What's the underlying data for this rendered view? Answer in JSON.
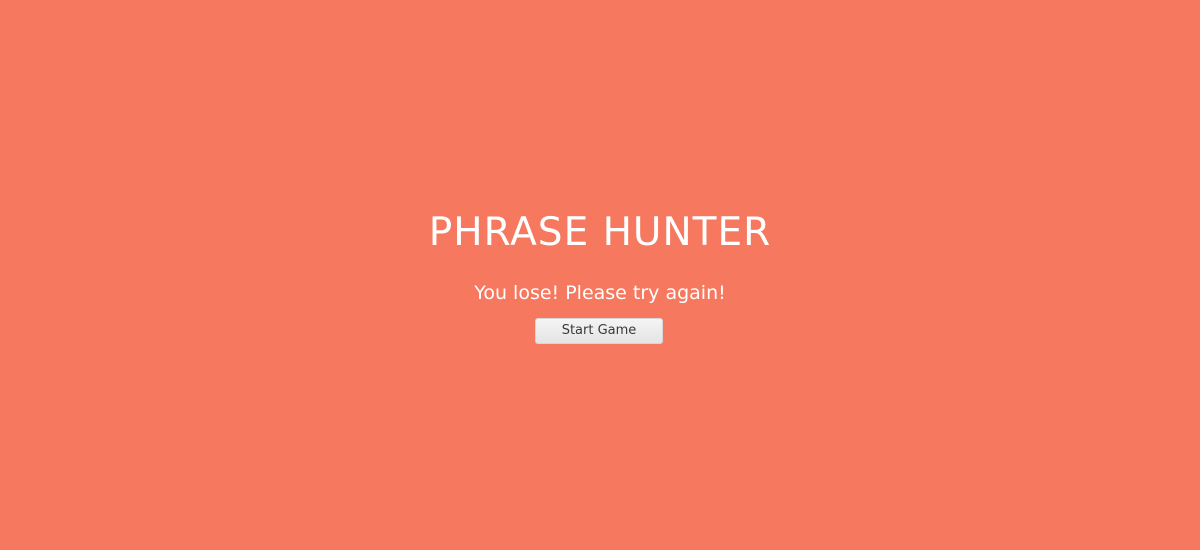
{
  "colors": {
    "background": "#f5785f",
    "text": "#ffffff",
    "button_bg": "#ececec",
    "button_text": "#3a3a3a"
  },
  "overlay": {
    "title": "PHRASE HUNTER",
    "message": "You lose! Please try again!",
    "start_button_label": "Start Game"
  }
}
